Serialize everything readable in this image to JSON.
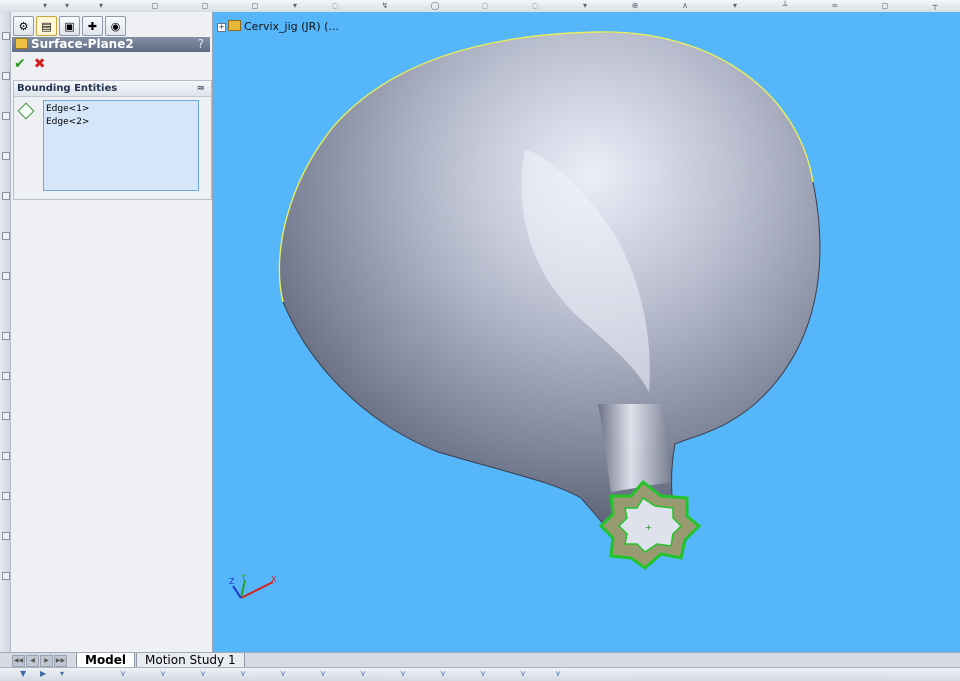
{
  "feature_panel": {
    "tabs": [
      {
        "icon": "feature-manager-icon",
        "glyph": "⚙"
      },
      {
        "icon": "property-manager-icon",
        "glyph": "▤"
      },
      {
        "icon": "configuration-manager-icon",
        "glyph": "▣"
      },
      {
        "icon": "dimxpert-icon",
        "glyph": "✚"
      },
      {
        "icon": "display-manager-icon",
        "glyph": "◉"
      }
    ],
    "title": "Surface-Plane2",
    "help_label": "?",
    "ok_glyph": "✔",
    "cancel_glyph": "✖",
    "bounding_group": {
      "header": "Bounding Entities",
      "collapse_glyph": "≈",
      "items": [
        "Edge<1>",
        "Edge<2>"
      ]
    }
  },
  "viewport": {
    "tree_expand": "+",
    "document_title": "Cervix_jig (JR)  (...",
    "triad": {
      "x_label": "X",
      "y_label": "Y",
      "z_label": "Z"
    },
    "colors": {
      "background": "#56b6fa",
      "selection": "#22c42a",
      "boundary": "#e8f060"
    }
  },
  "bottom_tabs": {
    "nav": [
      "◀◀",
      "◀",
      "▶",
      "▶▶"
    ],
    "model_label": "Model",
    "motion_label": "Motion Study 1"
  }
}
